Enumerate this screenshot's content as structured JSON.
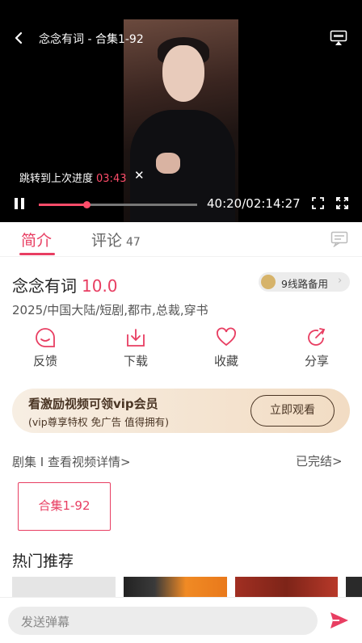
{
  "player": {
    "title": "念念有词 - 合集1-92",
    "resume_text": "跳转到上次进度",
    "resume_time": "03:43",
    "time_display": "40:20/02:14:27",
    "progress_fraction": 0.3
  },
  "tabs": {
    "intro": "简介",
    "comments": "评论",
    "comments_count": "47"
  },
  "drama": {
    "name": "念念有词",
    "score": "10.0",
    "line_button": "9线路备用",
    "meta": "2025/中国大陆/短剧,都市,总裁,穿书"
  },
  "actions": [
    {
      "label": "反馈",
      "icon": "feedback-icon"
    },
    {
      "label": "下载",
      "icon": "download-icon"
    },
    {
      "label": "收藏",
      "icon": "heart-icon"
    },
    {
      "label": "分享",
      "icon": "share-icon"
    }
  ],
  "banner": {
    "headline": "看激励视频可领vip会员",
    "subline": "(vip尊享特权 免广告 值得拥有)",
    "button": "立即观看"
  },
  "episodes": {
    "header": "剧集 I 查看视频详情>",
    "status": "已完结>",
    "items": [
      "合集1-92"
    ]
  },
  "hot": {
    "title": "热门推荐"
  },
  "bottom": {
    "danmu_placeholder": "发送弹幕"
  },
  "colors": {
    "accent": "#e83e62",
    "banner_text": "#4a3524"
  }
}
